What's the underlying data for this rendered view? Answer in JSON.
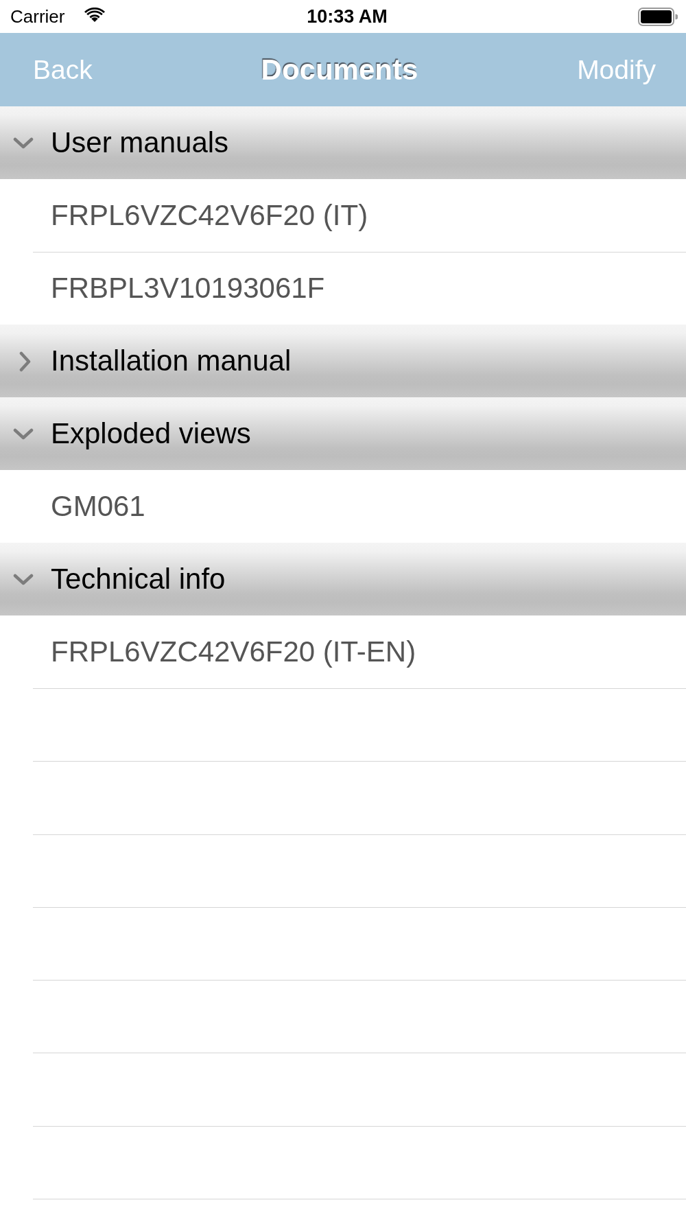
{
  "status_bar": {
    "carrier": "Carrier",
    "time": "10:33 AM"
  },
  "nav_bar": {
    "back": "Back",
    "title": "Documents",
    "action": "Modify"
  },
  "sections": [
    {
      "title": "User manuals",
      "expanded": true,
      "items": [
        "FRPL6VZC42V6F20 (IT)",
        "FRBPL3V10193061F"
      ]
    },
    {
      "title": "Installation manual",
      "expanded": false
    },
    {
      "title": "Exploded views",
      "expanded": true,
      "items": [
        "GM061"
      ]
    },
    {
      "title": "Technical info",
      "expanded": true,
      "items": [
        "FRPL6VZC42V6F20 (IT-EN)"
      ]
    }
  ]
}
